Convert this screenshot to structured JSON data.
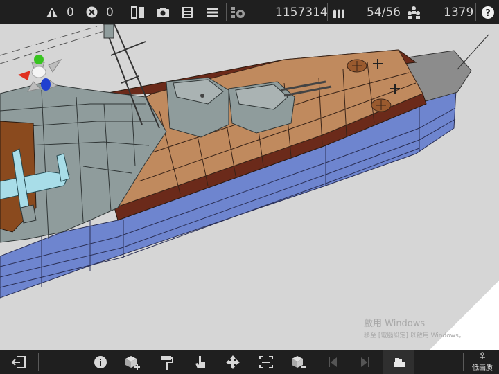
{
  "status": {
    "warnings": "0",
    "errors": "0",
    "weight": "1157314",
    "ammo": "54/56",
    "crew": "1379"
  },
  "icons": {
    "warning": "warning-icon",
    "error": "error-icon",
    "mirror": "mirror-icon",
    "camera": "camera-icon",
    "save": "save-icon",
    "menu": "menu-icon",
    "weight": "weight-icon",
    "ammo": "ammo-icon",
    "crew": "crew-icon",
    "help": "help-icon"
  },
  "toolbar": {
    "quality_label": "低画质"
  },
  "watermark": {
    "line1": "啟用 Windows",
    "line2": "移至 [電腦設定] 以啟用 Windows。"
  },
  "colors": {
    "bar": "#1f1f1f",
    "hull_blue": "#6f86cc",
    "deck_wood": "#c08a5e",
    "deck_edge": "#6b2a1a",
    "superstructure": "#8f9c9c",
    "aircraft": "#a8dde8",
    "background": "#d6d6d6"
  }
}
